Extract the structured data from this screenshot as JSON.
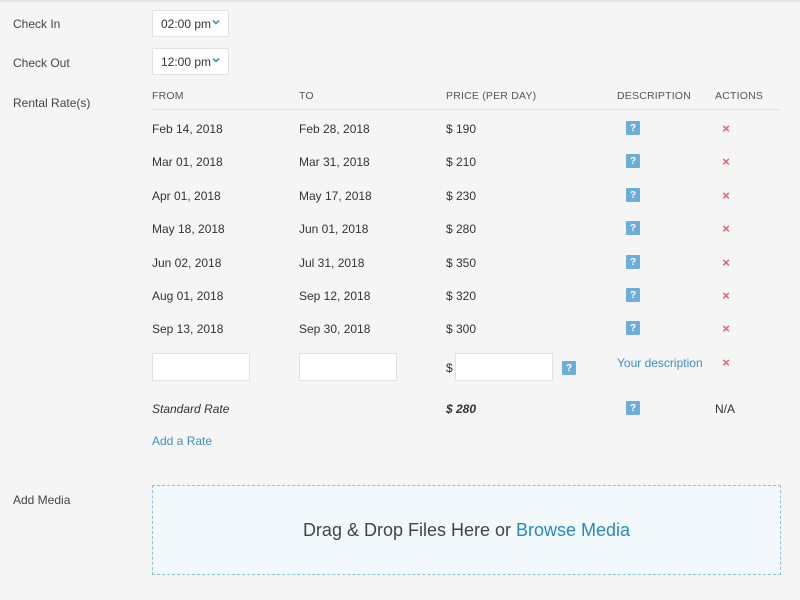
{
  "checkin": {
    "label": "Check In",
    "value": "02:00 pm"
  },
  "checkout": {
    "label": "Check Out",
    "value": "12:00 pm"
  },
  "rental": {
    "label": "Rental Rate(s)",
    "columns": {
      "from": "FROM",
      "to": "TO",
      "price": "PRICE (PER DAY)",
      "description": "DESCRIPTION",
      "actions": "ACTIONS"
    },
    "rows": [
      {
        "from": "Feb 14, 2018",
        "to": "Feb 28, 2018",
        "price": "$ 190"
      },
      {
        "from": "Mar 01, 2018",
        "to": "Mar 31, 2018",
        "price": "$ 210"
      },
      {
        "from": "Apr 01, 2018",
        "to": "May 17, 2018",
        "price": "$ 230"
      },
      {
        "from": "May 18, 2018",
        "to": "Jun 01, 2018",
        "price": "$ 280"
      },
      {
        "from": "Jun 02, 2018",
        "to": "Jul 31, 2018",
        "price": "$ 350"
      },
      {
        "from": "Aug 01, 2018",
        "to": "Sep 12, 2018",
        "price": "$ 320"
      },
      {
        "from": "Sep 13, 2018",
        "to": "Sep 30, 2018",
        "price": "$ 300"
      }
    ],
    "new_row": {
      "currency": "$",
      "description_link": "Your description"
    },
    "standard": {
      "label": "Standard Rate",
      "price": "$ 280",
      "action": "N/A"
    },
    "add_rate": "Add a Rate",
    "help_glyph": "?",
    "delete_glyph": "×"
  },
  "media": {
    "label": "Add Media",
    "drop_text": "Drag & Drop Files Here or",
    "browse_link": "Browse Media"
  },
  "icons": {
    "help": "question-icon",
    "delete": "close-icon",
    "dropdown": "chevron-down-icon"
  },
  "colors": {
    "accent": "#3d8fc8",
    "help_bg": "#6aaed9",
    "delete": "#e0606a",
    "dropzone_bg": "#f1f9fd"
  }
}
